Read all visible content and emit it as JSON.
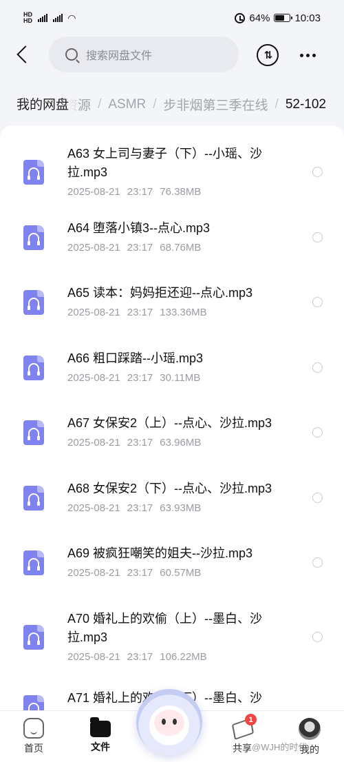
{
  "status_bar": {
    "left_network": "HD 5G 4G",
    "battery": "64%",
    "battery_level": 0.64,
    "time": "10:03"
  },
  "header": {
    "search_placeholder": "搜索网盘文件",
    "sort_icon": "sort-arrows-icon",
    "more_icon": "more-dots-icon"
  },
  "breadcrumb": {
    "root": "我的网盘",
    "items": [
      "资源",
      "ASMR",
      "步非烟第三季在线",
      "52-102"
    ],
    "separator": "/"
  },
  "files": [
    {
      "name": "A63 女上司与妻子（下）--小瑶、沙拉.mp3",
      "date": "2025-08-21",
      "time": "23:17",
      "size": "76.38MB"
    },
    {
      "name": "A64 堕落小镇3--点心.mp3",
      "date": "2025-08-21",
      "time": "23:17",
      "size": "68.76MB"
    },
    {
      "name": "A65 读本：妈妈拒还迎--点心.mp3",
      "date": "2025-08-21",
      "time": "23:17",
      "size": "133.36MB"
    },
    {
      "name": "A66 粗口踩踏--小瑶.mp3",
      "date": "2025-08-21",
      "time": "23:17",
      "size": "30.11MB"
    },
    {
      "name": "A67 女保安2（上）--点心、沙拉.mp3",
      "date": "2025-08-21",
      "time": "23:17",
      "size": "63.96MB"
    },
    {
      "name": "A68 女保安2（下）--点心、沙拉.mp3",
      "date": "2025-08-21",
      "time": "23:17",
      "size": "63.93MB"
    },
    {
      "name": "A69 被疯狂嘲笑的姐夫--沙拉.mp3",
      "date": "2025-08-21",
      "time": "23:17",
      "size": "60.57MB"
    },
    {
      "name": "A70 婚礼上的欢偷（上）--墨白、沙拉.mp3",
      "date": "2025-08-21",
      "time": "23:17",
      "size": "106.22MB"
    },
    {
      "name": "A71 婚礼上的欢偷（下）--墨白、沙",
      "date": "",
      "time": "",
      "size": ""
    }
  ],
  "bottom_nav": {
    "home": "首页",
    "files": "文件",
    "share": "共享",
    "share_badge": "1",
    "mine": "我的"
  },
  "watermark": "@WJH的时代",
  "colors": {
    "accent": "#7e83f0",
    "badge": "#f04545",
    "page_bg": "#f4f5f8"
  }
}
